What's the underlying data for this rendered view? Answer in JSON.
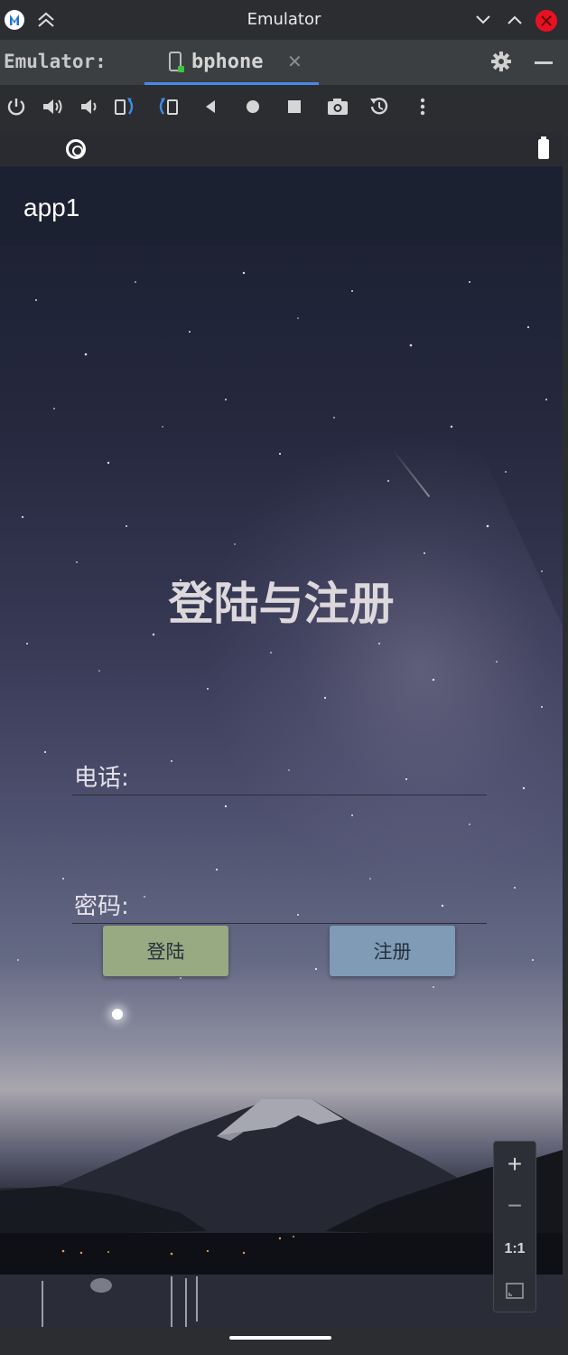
{
  "window": {
    "title": "Emulator"
  },
  "tool_window": {
    "label": "Emulator:",
    "device_tab": "bphone"
  },
  "device": {
    "app_title": "app1",
    "page_title": "登陆与注册",
    "phone_label": "电话:",
    "password_label": "密码:",
    "login_button": "登陆",
    "register_button": "注册",
    "phone_value": "",
    "password_value": ""
  },
  "zoom_controls": {
    "zoom_in": "+",
    "zoom_out": "−",
    "actual_size": "1:1"
  },
  "colors": {
    "accent_tab": "#4a88e8",
    "login_button": "#97aa82",
    "register_button": "#7f9bb6",
    "app_bar": "#1c2131",
    "close_button": "#e81123"
  },
  "icons": {
    "toolbar": [
      "power-icon",
      "volume-up-icon",
      "volume-down-icon",
      "rotate-left-icon",
      "rotate-right-icon",
      "back-icon",
      "home-icon",
      "overview-icon",
      "screenshot-icon",
      "snapshot-icon",
      "more-icon"
    ]
  }
}
